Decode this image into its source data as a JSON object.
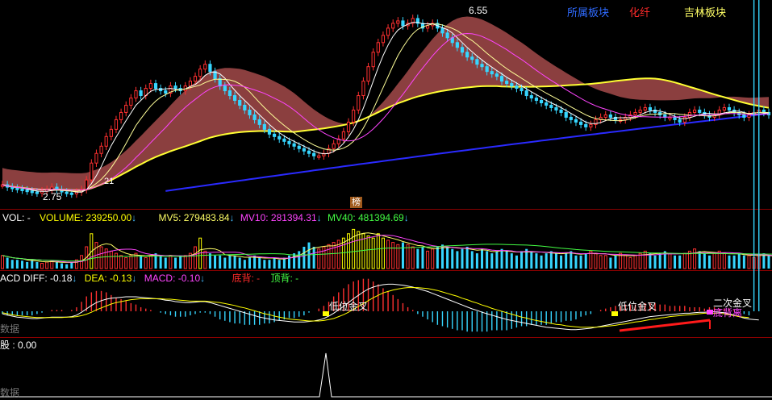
{
  "header": {
    "sector_label": "所属板块",
    "sector_1": "化纤",
    "sector_2": "吉林板块",
    "colors": {
      "sector_label": "#2f6bff",
      "sector_1": "#ff2a2a",
      "sector_2": "#ffff66"
    }
  },
  "price_panel": {
    "high_label": "6.55",
    "low_label": "2.75",
    "clipped_label": "21",
    "badge": "榜"
  },
  "volume_panel": {
    "name": "VOL:",
    "dash": "-",
    "volume": "VOLUME: 239250.00",
    "mv5": "MV5: 279483.84",
    "mv10": "MV10: 281394.31",
    "mv40": "MV40: 481394.69",
    "arrow": "↓",
    "colors": {
      "volume": "#ffff00",
      "mv5": "#ffff66",
      "mv10": "#ff44ff",
      "mv40": "#44ff44"
    }
  },
  "macd_panel": {
    "name": "ACD",
    "diff": "DIFF: -0.18",
    "dea": "DEA: -0.13",
    "macd": "MACD: -0.10",
    "bottom_div": "底背: -",
    "top_div": "顶背: -",
    "arrow": "↓",
    "label_lowcross_1": "低位金叉",
    "label_lowcross_2": "低位金叉",
    "label_second_cross": "二次金叉",
    "label_bottom_div": "底背离",
    "no_data": "数据",
    "colors": {
      "diff": "#ffffff",
      "dea": "#ffff00",
      "macd": "#ff44ff",
      "bottom_div": "#ff2a2a",
      "top_div": "#44ff44"
    }
  },
  "bottom_panel": {
    "label": "股 : 0.00",
    "no_data": "数据"
  },
  "chart_data": [
    {
      "type": "candlestick",
      "xlabel": "",
      "ylabel": "",
      "ylim": [
        2.6,
        6.7
      ],
      "max_price": 6.55,
      "min_price": 2.75,
      "close": [
        2.95,
        2.9,
        2.88,
        2.86,
        2.84,
        2.82,
        2.8,
        2.78,
        2.82,
        2.85,
        2.9,
        2.85,
        2.8,
        2.78,
        2.76,
        2.8,
        2.85,
        3.05,
        3.4,
        3.6,
        3.75,
        3.95,
        4.1,
        4.3,
        4.45,
        4.6,
        4.75,
        4.9,
        4.8,
        4.95,
        5.05,
        4.95,
        4.9,
        4.85,
        5.0,
        4.95,
        4.9,
        5.0,
        5.1,
        5.2,
        5.35,
        5.45,
        5.3,
        5.15,
        5.0,
        4.9,
        4.8,
        4.7,
        4.6,
        4.5,
        4.4,
        4.3,
        4.2,
        4.1,
        4.0,
        3.95,
        3.9,
        3.85,
        3.8,
        3.75,
        3.7,
        3.65,
        3.6,
        3.55,
        3.55,
        3.6,
        3.7,
        3.8,
        3.9,
        4.05,
        4.25,
        4.5,
        4.8,
        5.1,
        5.4,
        5.7,
        5.9,
        6.05,
        6.2,
        6.3,
        6.35,
        6.25,
        6.3,
        6.4,
        6.3,
        6.2,
        6.25,
        6.3,
        6.2,
        6.1,
        6.0,
        5.9,
        5.8,
        5.7,
        5.6,
        5.55,
        5.45,
        5.4,
        5.3,
        5.25,
        5.2,
        5.1,
        5.05,
        5.0,
        4.95,
        4.9,
        4.8,
        4.75,
        4.7,
        4.65,
        4.6,
        4.55,
        4.5,
        4.45,
        4.35,
        4.3,
        4.25,
        4.2,
        4.15,
        4.2,
        4.3,
        4.35,
        4.4,
        4.35,
        4.3,
        4.3,
        4.35,
        4.4,
        4.45,
        4.5,
        4.55,
        4.5,
        4.45,
        4.4,
        4.35,
        4.35,
        4.3,
        4.25,
        4.35,
        4.45,
        4.5,
        4.45,
        4.4,
        4.35,
        4.4,
        4.5,
        4.55,
        4.5,
        4.45,
        4.4,
        4.35,
        4.4,
        4.45,
        4.5,
        4.45,
        4.4
      ]
    },
    {
      "type": "bar",
      "series": [
        {
          "values": [
            0.3,
            0.25,
            0.2,
            0.2,
            0.18,
            0.15,
            0.2,
            0.15,
            0.12,
            0.15,
            0.18,
            0.15,
            0.12,
            0.1,
            0.15,
            0.2,
            0.3,
            0.5,
            0.8,
            0.6,
            0.5,
            0.45,
            0.4,
            0.35,
            0.3,
            0.25,
            0.3,
            0.35,
            0.3,
            0.25,
            0.3,
            0.35,
            0.3,
            0.25,
            0.3,
            0.25,
            0.3,
            0.3,
            0.35,
            0.5,
            0.7,
            0.4,
            0.35,
            0.3,
            0.3,
            0.25,
            0.3,
            0.3,
            0.25,
            0.2,
            0.25,
            0.3,
            0.25,
            0.2,
            0.2,
            0.25,
            0.2,
            0.25,
            0.3,
            0.35,
            0.4,
            0.5,
            0.6,
            0.5,
            0.45,
            0.5,
            0.55,
            0.6,
            0.65,
            0.7,
            0.8,
            0.9,
            0.85,
            0.8,
            0.75,
            0.7,
            0.8,
            0.7,
            0.65,
            0.6,
            0.55,
            0.6,
            0.55,
            0.5,
            0.45,
            0.5,
            0.4,
            0.45,
            0.5,
            0.55,
            0.5,
            0.45,
            0.4,
            0.45,
            0.5,
            0.4,
            0.35,
            0.45,
            0.4,
            0.35,
            0.4,
            0.45,
            0.4,
            0.35,
            0.3,
            0.4,
            0.45,
            0.4,
            0.35,
            0.3,
            0.35,
            0.4,
            0.35,
            0.3,
            0.35,
            0.4,
            0.3,
            0.3,
            0.35,
            0.4,
            0.35,
            0.3,
            0.3,
            0.25,
            0.3,
            0.35,
            0.3,
            0.25,
            0.3,
            0.35,
            0.4,
            0.35,
            0.3,
            0.35,
            0.4,
            0.35,
            0.3,
            0.3,
            0.35,
            0.4,
            0.45,
            0.4,
            0.35,
            0.3,
            0.35,
            0.4,
            0.35,
            0.3,
            0.3,
            0.35,
            0.3,
            0.3,
            0.25,
            0.3,
            0.35,
            0.3,
            0.25,
            0.3
          ]
        }
      ]
    },
    {
      "type": "line",
      "series": [
        {
          "name": "DIFF",
          "values": [
            -0.05,
            -0.08,
            -0.1,
            -0.12,
            -0.13,
            -0.14,
            -0.15,
            -0.15,
            -0.14,
            -0.13,
            -0.12,
            -0.12,
            -0.12,
            -0.12,
            -0.11,
            -0.08,
            -0.02,
            0.05,
            0.12,
            0.18,
            0.22,
            0.25,
            0.27,
            0.28,
            0.29,
            0.3,
            0.3,
            0.3,
            0.29,
            0.28,
            0.27,
            0.26,
            0.25,
            0.23,
            0.22,
            0.2,
            0.19,
            0.18,
            0.18,
            0.19,
            0.2,
            0.2,
            0.18,
            0.15,
            0.12,
            0.09,
            0.06,
            0.03,
            0.0,
            -0.03,
            -0.06,
            -0.09,
            -0.12,
            -0.14,
            -0.16,
            -0.18,
            -0.19,
            -0.2,
            -0.21,
            -0.22,
            -0.22,
            -0.22,
            -0.21,
            -0.2,
            -0.18,
            -0.15,
            -0.1,
            -0.04,
            0.03,
            0.1,
            0.18,
            0.26,
            0.33,
            0.4,
            0.46,
            0.5,
            0.53,
            0.55,
            0.56,
            0.56,
            0.55,
            0.54,
            0.52,
            0.5,
            0.47,
            0.44,
            0.41,
            0.37,
            0.33,
            0.29,
            0.25,
            0.21,
            0.17,
            0.13,
            0.09,
            0.05,
            0.02,
            -0.02,
            -0.05,
            -0.08,
            -0.11,
            -0.14,
            -0.17,
            -0.19,
            -0.21,
            -0.23,
            -0.25,
            -0.27,
            -0.29,
            -0.31,
            -0.33,
            -0.34,
            -0.35,
            -0.36,
            -0.37,
            -0.38,
            -0.38,
            -0.37,
            -0.36,
            -0.35,
            -0.33,
            -0.31,
            -0.29,
            -0.27,
            -0.25,
            -0.23,
            -0.21,
            -0.19,
            -0.17,
            -0.15,
            -0.13,
            -0.11,
            -0.1,
            -0.09,
            -0.08,
            -0.07,
            -0.06,
            -0.05,
            -0.04,
            -0.04,
            -0.03,
            -0.02,
            -0.02,
            -0.01,
            -0.01,
            -0.02,
            -0.03,
            -0.05,
            -0.08,
            -0.11,
            -0.14,
            -0.16,
            -0.17,
            -0.18
          ]
        },
        {
          "name": "DEA",
          "values": [
            -0.03,
            -0.05,
            -0.07,
            -0.09,
            -0.1,
            -0.11,
            -0.12,
            -0.13,
            -0.13,
            -0.13,
            -0.13,
            -0.13,
            -0.13,
            -0.12,
            -0.12,
            -0.11,
            -0.09,
            -0.06,
            -0.02,
            0.03,
            0.07,
            0.11,
            0.15,
            0.18,
            0.2,
            0.22,
            0.24,
            0.25,
            0.26,
            0.26,
            0.26,
            0.26,
            0.26,
            0.25,
            0.25,
            0.24,
            0.23,
            0.22,
            0.21,
            0.21,
            0.21,
            0.21,
            0.2,
            0.19,
            0.18,
            0.16,
            0.14,
            0.12,
            0.09,
            0.07,
            0.04,
            0.01,
            -0.02,
            -0.05,
            -0.07,
            -0.1,
            -0.12,
            -0.14,
            -0.16,
            -0.17,
            -0.18,
            -0.19,
            -0.2,
            -0.2,
            -0.2,
            -0.19,
            -0.17,
            -0.15,
            -0.11,
            -0.07,
            -0.02,
            0.04,
            0.1,
            0.16,
            0.22,
            0.28,
            0.33,
            0.38,
            0.41,
            0.44,
            0.46,
            0.48,
            0.49,
            0.49,
            0.49,
            0.48,
            0.47,
            0.45,
            0.43,
            0.4,
            0.37,
            0.34,
            0.31,
            0.27,
            0.24,
            0.2,
            0.17,
            0.13,
            0.1,
            0.06,
            0.03,
            0.0,
            -0.03,
            -0.06,
            -0.09,
            -0.12,
            -0.14,
            -0.17,
            -0.19,
            -0.21,
            -0.23,
            -0.25,
            -0.27,
            -0.28,
            -0.3,
            -0.31,
            -0.32,
            -0.33,
            -0.33,
            -0.33,
            -0.33,
            -0.32,
            -0.31,
            -0.3,
            -0.29,
            -0.27,
            -0.26,
            -0.24,
            -0.22,
            -0.21,
            -0.19,
            -0.17,
            -0.16,
            -0.14,
            -0.13,
            -0.11,
            -0.1,
            -0.09,
            -0.08,
            -0.07,
            -0.06,
            -0.05,
            -0.04,
            -0.04,
            -0.04,
            -0.04,
            -0.05,
            -0.07,
            -0.09,
            -0.11,
            -0.12,
            -0.13
          ]
        }
      ]
    }
  ]
}
